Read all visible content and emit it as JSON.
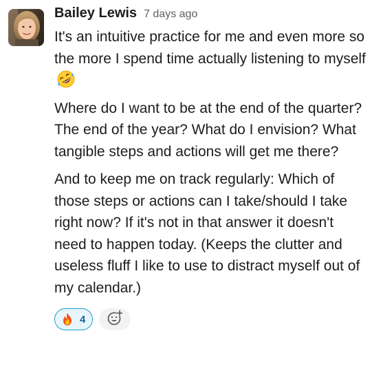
{
  "message": {
    "author": "Bailey Lewis",
    "timestamp": "7 days ago",
    "avatar_icon": "user-avatar-photo",
    "paragraphs": [
      "It's an intuitive practice for me and even more so the more I spend time actually listening to myself",
      "Where do I want to be at the end of the quarter? The end of the year? What do I envision? What tangible steps and actions will get me there?",
      "And to keep me on track regularly: Which of those steps or actions can I take/should I take right now? If it's not in that answer it doesn't need to happen today. (Keeps the clutter and useless fluff I like to use to distract myself out of my calendar.)"
    ],
    "inline_emoji": "rolling-on-floor-laughing-emoji"
  },
  "reactions": [
    {
      "emoji": "fire-emoji",
      "count": "4",
      "selected": true
    }
  ],
  "add_reaction": {
    "icon": "add-reaction-icon"
  },
  "colors": {
    "text": "#1d1c1d",
    "timestamp": "#616061",
    "reaction_border": "#1d9bd1",
    "reaction_bg": "#e8f5fa",
    "reaction_count": "#1264a3"
  }
}
